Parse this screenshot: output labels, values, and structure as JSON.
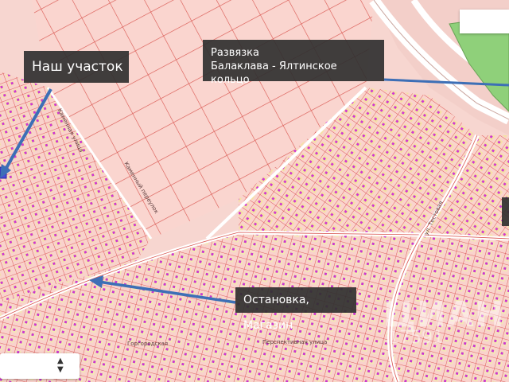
{
  "labels": {
    "our_plot": "Наш участок",
    "junction_line1": "Развязка",
    "junction_line2": "Балаклава - Ялтинское кольцо",
    "stop_shop": "Остановка, Магазин"
  },
  "streets": {
    "kamennaya": "Каменная улица",
    "kamenny_per": "Каменный переулок",
    "gorodovaya": "Горгородская",
    "testovaya": "ул. Тестовая",
    "perspektivnaya": "Перспективная улица"
  },
  "watermark": {
    "main": "ЦИАН",
    "sub": "17591"
  },
  "colors": {
    "background": "#f7d6d0",
    "parcel_fill": "#fbd3d0",
    "parcel_yellow": "#f6e3a8",
    "parcel_line": "#d43b3b",
    "building": "#d03ad0",
    "road": "#ffffff",
    "highway_green": "#8fd07a",
    "arrow": "#3d6fb6",
    "callout_bg": "#303030"
  },
  "icons": {
    "zoom_control": "up-down-arrows-icon"
  }
}
